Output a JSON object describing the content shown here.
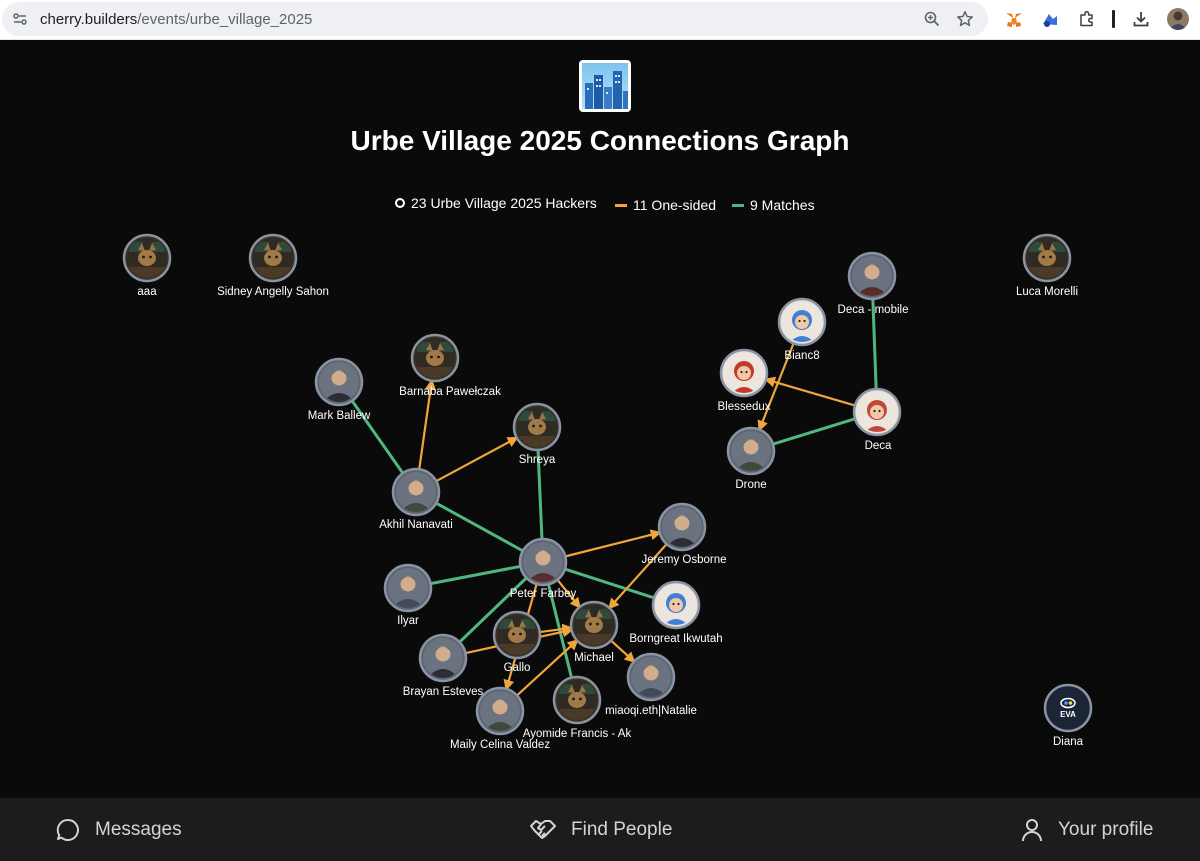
{
  "browser": {
    "url_domain": "cherry.builders",
    "url_path": "/events/urbe_village_2025"
  },
  "page": {
    "title": "Urbe Village 2025 Connections Graph",
    "legend": {
      "hackers": "23 Urbe Village 2025 Hackers",
      "one_sided": "11 One-sided",
      "matches": "9 Matches",
      "colors": {
        "one_sided": "#f0a63c",
        "matches": "#4fb77f",
        "ring": "#8a93a3"
      }
    }
  },
  "graph": {
    "nodes": [
      {
        "id": "aaa",
        "label": "aaa",
        "avatar": "cat-hacker"
      },
      {
        "id": "sidney",
        "label": "Sidney Angelly Sahon",
        "avatar": "cat-hacker"
      },
      {
        "id": "luca",
        "label": "Luca Morelli",
        "avatar": "cat-hacker"
      },
      {
        "id": "mark",
        "label": "Mark Ballew",
        "avatar": "person-photo"
      },
      {
        "id": "barnaba",
        "label": "Barnaba Pawełczak",
        "avatar": "cat-hacker"
      },
      {
        "id": "shreya",
        "label": "Shreya",
        "avatar": "cat-hacker"
      },
      {
        "id": "akhil",
        "label": "Akhil Nanavati",
        "avatar": "person-photo"
      },
      {
        "id": "peter",
        "label": "Peter Farbey",
        "avatar": "person-photo"
      },
      {
        "id": "jeremy",
        "label": "Jeremy Osborne",
        "avatar": "person-photo"
      },
      {
        "id": "ilyar",
        "label": "Ilyar",
        "avatar": "person-photo"
      },
      {
        "id": "borngreat",
        "label": "Borngreat Ikwutah",
        "avatar": "cartoon-avatar"
      },
      {
        "id": "michael",
        "label": "Michael",
        "avatar": "cat-hacker"
      },
      {
        "id": "gallo",
        "label": "Gallo",
        "avatar": "cat-hacker"
      },
      {
        "id": "brayan",
        "label": "Brayan Esteves",
        "avatar": "person-photo"
      },
      {
        "id": "miaoqi",
        "label": "miaoqi.eth|Natalie",
        "avatar": "person-photo"
      },
      {
        "id": "ayomide",
        "label": "Ayomide Francis - Ak",
        "avatar": "cat-hacker"
      },
      {
        "id": "maily",
        "label": "Maily Celina Valdez",
        "avatar": "person-photo"
      },
      {
        "id": "decamobile",
        "label": "Deca - mobile",
        "avatar": "person-photo"
      },
      {
        "id": "bianc8",
        "label": "Bianc8",
        "avatar": "cartoon-avatar"
      },
      {
        "id": "blessedux",
        "label": "Blessedux",
        "avatar": "cartoon-avatar"
      },
      {
        "id": "deca",
        "label": "Deca",
        "avatar": "cartoon-avatar"
      },
      {
        "id": "drone",
        "label": "Drone",
        "avatar": "person-photo"
      },
      {
        "id": "diana",
        "label": "Diana",
        "avatar": "eva-logo",
        "avatar_text": "EVA"
      }
    ],
    "edges": [
      {
        "from": "mark",
        "to": "akhil",
        "type": "match"
      },
      {
        "from": "akhil",
        "to": "barnaba",
        "type": "one-sided"
      },
      {
        "from": "akhil",
        "to": "shreya",
        "type": "one-sided"
      },
      {
        "from": "akhil",
        "to": "peter",
        "type": "match"
      },
      {
        "from": "shreya",
        "to": "peter",
        "type": "match"
      },
      {
        "from": "peter",
        "to": "jeremy",
        "type": "one-sided"
      },
      {
        "from": "peter",
        "to": "borngreat",
        "type": "match"
      },
      {
        "from": "ilyar",
        "to": "peter",
        "type": "match"
      },
      {
        "from": "peter",
        "to": "michael",
        "type": "one-sided"
      },
      {
        "from": "peter",
        "to": "ayomide",
        "type": "match"
      },
      {
        "from": "brayan",
        "to": "peter",
        "type": "match"
      },
      {
        "from": "peter",
        "to": "maily",
        "type": "one-sided"
      },
      {
        "from": "jeremy",
        "to": "michael",
        "type": "one-sided"
      },
      {
        "from": "gallo",
        "to": "michael",
        "type": "one-sided"
      },
      {
        "from": "brayan",
        "to": "michael",
        "type": "one-sided"
      },
      {
        "from": "michael",
        "to": "miaoqi",
        "type": "one-sided"
      },
      {
        "from": "maily",
        "to": "michael",
        "type": "one-sided"
      },
      {
        "from": "decamobile",
        "to": "deca",
        "type": "match"
      },
      {
        "from": "deca",
        "to": "blessedux",
        "type": "one-sided"
      },
      {
        "from": "bianc8",
        "to": "drone",
        "type": "one-sided"
      },
      {
        "from": "deca",
        "to": "drone",
        "type": "match"
      }
    ]
  },
  "nav": {
    "messages": "Messages",
    "find_people": "Find People",
    "your_profile": "Your profile"
  }
}
